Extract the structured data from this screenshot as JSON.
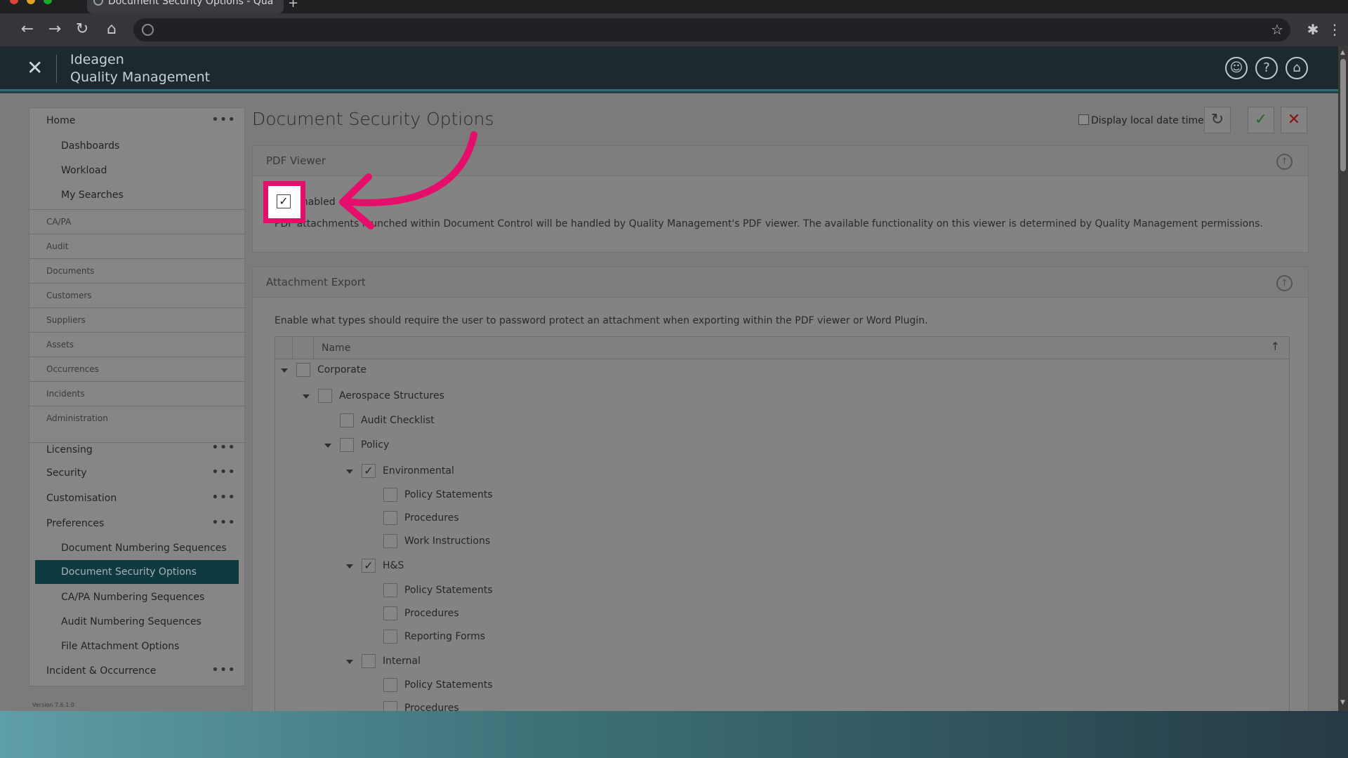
{
  "browser": {
    "tab_title": "Document Security Options - Qua",
    "new_tab": "+",
    "back_icon": "arrow-left-icon",
    "forward_icon": "arrow-right-icon"
  },
  "app": {
    "brand_line1": "Ideagen",
    "brand_line2": "Quality Management"
  },
  "sidebar": {
    "top_items": [
      {
        "label": "Home"
      },
      {
        "label": "Dashboards"
      },
      {
        "label": "Workload"
      },
      {
        "label": "My Searches"
      }
    ],
    "sections": [
      "CA/PA",
      "Audit",
      "Documents",
      "Customers",
      "Suppliers",
      "Assets",
      "Occurrences",
      "Incidents",
      "Administration"
    ],
    "admin_items": [
      "Licensing",
      "Security",
      "Customisation",
      "Preferences"
    ],
    "pref_items": [
      "Document Numbering Sequences",
      "Document Security Options",
      "CA/PA Numbering Sequences",
      "Audit Numbering Sequences",
      "File Attachment Options"
    ],
    "last_item": "Incident & Occurrence",
    "version": "Version 7.6.1.0"
  },
  "page": {
    "title": "Document Security Options",
    "local_date_label": "Display local date time"
  },
  "pdf_viewer": {
    "heading": "PDF Viewer",
    "enabled_label": "Enabled",
    "enabled": true,
    "description": "PDF attachments launched within Document Control will be handled by Quality Management's PDF viewer. The available functionality on this viewer is determined by Quality Management permissions."
  },
  "attachment_export": {
    "heading": "Attachment Export",
    "description": "Enable what types should require the user to password protect an attachment when exporting within the PDF viewer or Word Plugin.",
    "column_name": "Name",
    "tree": [
      {
        "label": "Corporate",
        "checked": false,
        "expanded": true
      },
      {
        "label": "Aerospace Structures",
        "checked": false,
        "expanded": true
      },
      {
        "label": "Audit Checklist",
        "checked": false
      },
      {
        "label": "Policy",
        "checked": false,
        "expanded": true
      },
      {
        "label": "Environmental",
        "checked": true,
        "expanded": true
      },
      {
        "label": "Policy Statements",
        "checked": false
      },
      {
        "label": "Procedures",
        "checked": false
      },
      {
        "label": "Work Instructions",
        "checked": false
      },
      {
        "label": "H&S",
        "checked": true,
        "expanded": true
      },
      {
        "label": "Policy Statements",
        "checked": false
      },
      {
        "label": "Procedures",
        "checked": false
      },
      {
        "label": "Reporting Forms",
        "checked": false
      },
      {
        "label": "Internal",
        "checked": false,
        "expanded": true
      },
      {
        "label": "Policy Statements",
        "checked": false
      },
      {
        "label": "Procedures",
        "checked": false
      }
    ]
  },
  "colors": {
    "highlight": "#e60e6b",
    "active_nav": "#0f3a42",
    "accept": "#1e6b2c",
    "cancel": "#8b1010"
  }
}
